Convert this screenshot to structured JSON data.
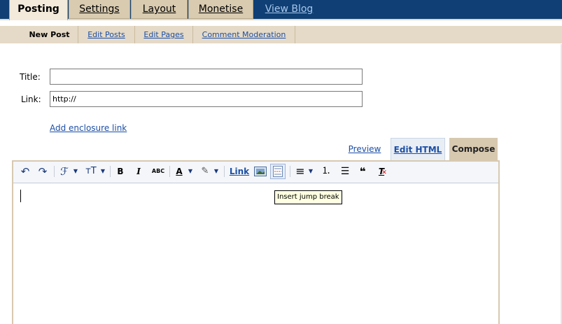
{
  "top_tabs": [
    "Posting",
    "Settings",
    "Layout",
    "Monetise",
    "View Blog"
  ],
  "sub_tabs": [
    "New Post",
    "Edit Posts",
    "Edit Pages",
    "Comment Moderation"
  ],
  "form": {
    "title_label": "Title:",
    "title_value": "",
    "link_label": "Link:",
    "link_value": "http://",
    "enclosure_link": "Add enclosure link"
  },
  "editor_modes": {
    "preview": "Preview",
    "edit_html": "Edit HTML",
    "compose": "Compose"
  },
  "toolbar": {
    "undo_icon": "↶",
    "redo_icon": "↷",
    "font_icon": "ℱ",
    "font_size_icon": "тT",
    "bold": "B",
    "italic": "I",
    "strikethrough": "ABC",
    "text_color_icon": "A",
    "highlight_icon": "✎",
    "link": "Link",
    "align_icon": "≡",
    "numbered_list_icon": "⒈",
    "bullet_list_icon": "☰",
    "blockquote_icon": "❝",
    "remove_format_icon": "T"
  },
  "tooltip": "Insert jump break"
}
